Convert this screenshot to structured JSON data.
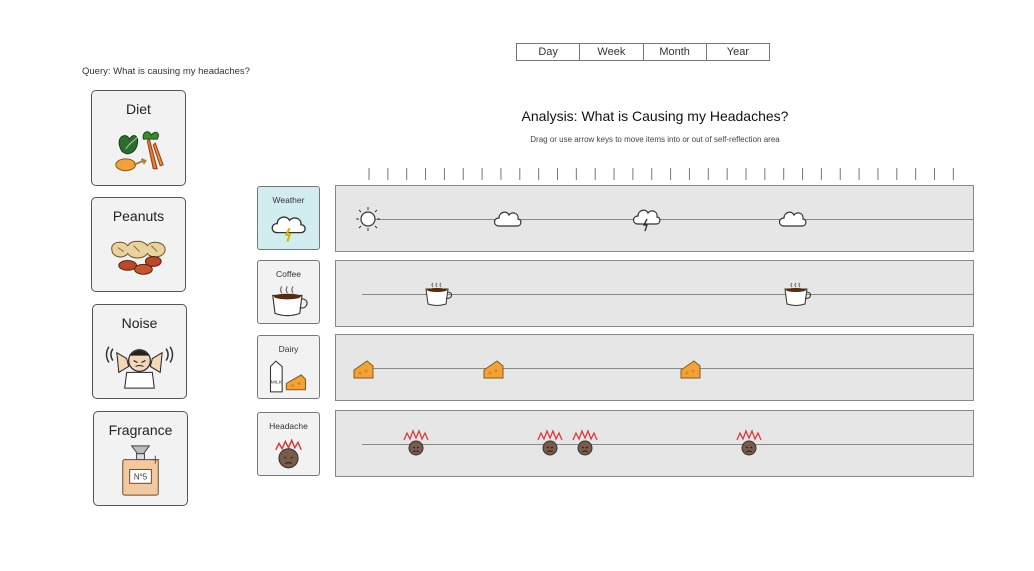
{
  "range_tabs": [
    "Day",
    "Week",
    "Month",
    "Year"
  ],
  "query": "Query: What is causing my headaches?",
  "analysis": {
    "title": "Analysis: What is Causing my Headaches?",
    "subtitle": "Drag or use arrow keys to move items into or out of self-reflection area"
  },
  "candidates": [
    {
      "label": "Diet",
      "icon": "diet-icon"
    },
    {
      "label": "Peanuts",
      "icon": "peanuts-icon"
    },
    {
      "label": "Noise",
      "icon": "noise-icon"
    },
    {
      "label": "Fragrance",
      "icon": "fragrance-icon"
    }
  ],
  "rows": [
    {
      "label": "Weather",
      "icon": "weather-icon",
      "active": true,
      "events": [
        "sun-icon",
        "cloud-icon",
        "storm-icon",
        "cloud-icon"
      ]
    },
    {
      "label": "Coffee",
      "icon": "coffee-icon",
      "active": false,
      "events": [
        "coffee-cup-icon",
        "coffee-cup-icon"
      ]
    },
    {
      "label": "Dairy",
      "icon": "dairy-icon",
      "active": false,
      "events": [
        "cheese-icon",
        "cheese-icon",
        "cheese-icon"
      ]
    },
    {
      "label": "Headache",
      "icon": "headache-icon",
      "active": false,
      "events": [
        "headache-icon",
        "headache-icon",
        "headache-icon",
        "headache-icon"
      ]
    }
  ],
  "perfume_label": "N°5",
  "milk_label": "MILK",
  "colors": {
    "active_row": "#d2edf0",
    "card_bg": "#f2f2f2",
    "track_bg": "#e6e6e6",
    "cheese": "#f2a23a",
    "headache_red": "#d93a3a"
  }
}
